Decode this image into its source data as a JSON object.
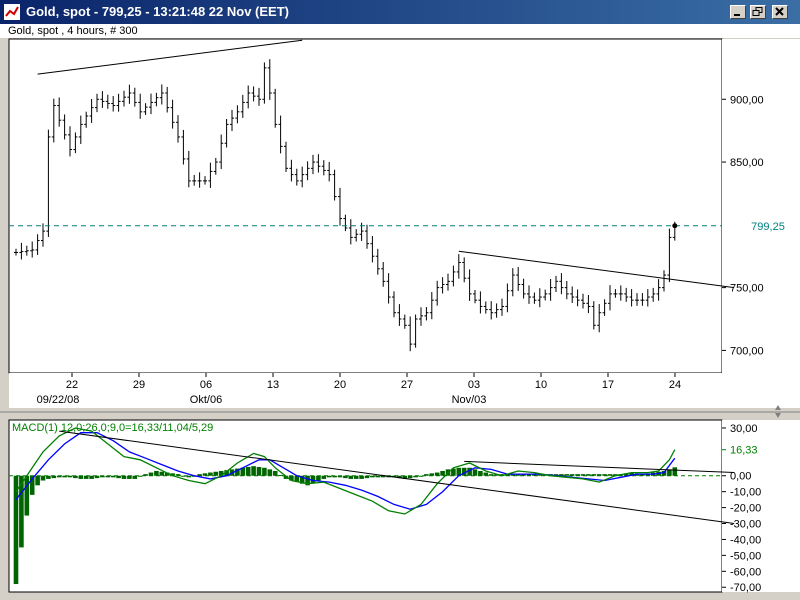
{
  "window": {
    "title": "Gold, spot - 799,25 - 13:21:48  22 Nov (EET)",
    "subtitle": "Gold, spot , 4 hours, # 300"
  },
  "colors": {
    "titlebar": "#0a246a",
    "price_bars": "#000000",
    "last_price_line": "#008080",
    "macd_line": "#008000",
    "signal_line": "#0000ff",
    "histogram": "#006400",
    "trend_lines": "#000000"
  },
  "chart_data": [
    {
      "type": "ohlc",
      "x_tick_labels": [
        "22",
        "29",
        "06",
        "13",
        "20",
        "27",
        "03",
        "10",
        "17",
        "24"
      ],
      "x_month_labels": [
        "09/22/08",
        "Okt/06",
        "Nov/03"
      ],
      "y_tick_labels": [
        "900,00",
        "850,00",
        "750,00",
        "700,00"
      ],
      "ylim": [
        682,
        948
      ],
      "last_price": 799.25,
      "last_price_label": "799,25",
      "close_series": [
        {
          "x": 0,
          "y": 778
        },
        {
          "x": 3,
          "y": 780
        },
        {
          "x": 5,
          "y": 795
        },
        {
          "x": 6,
          "y": 870
        },
        {
          "x": 7,
          "y": 895
        },
        {
          "x": 10,
          "y": 860
        },
        {
          "x": 12,
          "y": 880
        },
        {
          "x": 15,
          "y": 900
        },
        {
          "x": 18,
          "y": 895
        },
        {
          "x": 21,
          "y": 905
        },
        {
          "x": 23,
          "y": 890
        },
        {
          "x": 27,
          "y": 905
        },
        {
          "x": 30,
          "y": 870
        },
        {
          "x": 32,
          "y": 835
        },
        {
          "x": 35,
          "y": 835
        },
        {
          "x": 37,
          "y": 850
        },
        {
          "x": 39,
          "y": 880
        },
        {
          "x": 41,
          "y": 890
        },
        {
          "x": 43,
          "y": 905
        },
        {
          "x": 45,
          "y": 900
        },
        {
          "x": 46,
          "y": 925
        },
        {
          "x": 47,
          "y": 905
        },
        {
          "x": 48,
          "y": 880
        },
        {
          "x": 50,
          "y": 845
        },
        {
          "x": 52,
          "y": 835
        },
        {
          "x": 55,
          "y": 850
        },
        {
          "x": 58,
          "y": 840
        },
        {
          "x": 60,
          "y": 805
        },
        {
          "x": 62,
          "y": 790
        },
        {
          "x": 64,
          "y": 795
        },
        {
          "x": 66,
          "y": 775
        },
        {
          "x": 68,
          "y": 755
        },
        {
          "x": 70,
          "y": 730
        },
        {
          "x": 72,
          "y": 720
        },
        {
          "x": 73,
          "y": 705
        },
        {
          "x": 74,
          "y": 725
        },
        {
          "x": 76,
          "y": 730
        },
        {
          "x": 78,
          "y": 750
        },
        {
          "x": 80,
          "y": 755
        },
        {
          "x": 82,
          "y": 770
        },
        {
          "x": 84,
          "y": 745
        },
        {
          "x": 86,
          "y": 735
        },
        {
          "x": 88,
          "y": 730
        },
        {
          "x": 90,
          "y": 735
        },
        {
          "x": 92,
          "y": 760
        },
        {
          "x": 94,
          "y": 745
        },
        {
          "x": 96,
          "y": 740
        },
        {
          "x": 98,
          "y": 745
        },
        {
          "x": 100,
          "y": 755
        },
        {
          "x": 102,
          "y": 745
        },
        {
          "x": 104,
          "y": 740
        },
        {
          "x": 106,
          "y": 735
        },
        {
          "x": 107,
          "y": 720
        },
        {
          "x": 108,
          "y": 730
        },
        {
          "x": 110,
          "y": 745
        },
        {
          "x": 112,
          "y": 745
        },
        {
          "x": 114,
          "y": 740
        },
        {
          "x": 116,
          "y": 740
        },
        {
          "x": 118,
          "y": 745
        },
        {
          "x": 119,
          "y": 750
        },
        {
          "x": 120,
          "y": 760
        },
        {
          "x": 121,
          "y": 790
        },
        {
          "x": 122,
          "y": 799.25
        }
      ],
      "trend_lines": [
        {
          "x1": 4,
          "y1": 920,
          "x2": 53,
          "y2": 947
        },
        {
          "x1": 82,
          "y1": 779,
          "x2": 133,
          "y2": 750
        }
      ]
    },
    {
      "type": "macd",
      "label": "MACD(1) 12,0;26,0;9,0=16,33/11,04/5,29",
      "y_tick_labels": [
        "30,00",
        "16,33",
        "0,00",
        "-10,00",
        "-20,00",
        "-30,00",
        "-40,00",
        "-50,00",
        "-60,00",
        "-70,00"
      ],
      "ylim": [
        -73,
        35
      ],
      "macd_line": [
        {
          "x": 0,
          "y": -10
        },
        {
          "x": 3,
          "y": 5
        },
        {
          "x": 5,
          "y": 15
        },
        {
          "x": 8,
          "y": 25
        },
        {
          "x": 11,
          "y": 30
        },
        {
          "x": 14,
          "y": 28
        },
        {
          "x": 17,
          "y": 20
        },
        {
          "x": 20,
          "y": 12
        },
        {
          "x": 23,
          "y": 10
        },
        {
          "x": 26,
          "y": 5
        },
        {
          "x": 29,
          "y": 0
        },
        {
          "x": 32,
          "y": -3
        },
        {
          "x": 35,
          "y": -5
        },
        {
          "x": 38,
          "y": 0
        },
        {
          "x": 41,
          "y": 8
        },
        {
          "x": 44,
          "y": 14
        },
        {
          "x": 46,
          "y": 12
        },
        {
          "x": 48,
          "y": 5
        },
        {
          "x": 51,
          "y": -3
        },
        {
          "x": 54,
          "y": -5
        },
        {
          "x": 57,
          "y": -4
        },
        {
          "x": 60,
          "y": -8
        },
        {
          "x": 63,
          "y": -12
        },
        {
          "x": 66,
          "y": -16
        },
        {
          "x": 69,
          "y": -22
        },
        {
          "x": 72,
          "y": -24
        },
        {
          "x": 75,
          "y": -18
        },
        {
          "x": 78,
          "y": -5
        },
        {
          "x": 81,
          "y": 5
        },
        {
          "x": 84,
          "y": 8
        },
        {
          "x": 87,
          "y": 3
        },
        {
          "x": 90,
          "y": 0
        },
        {
          "x": 93,
          "y": 3
        },
        {
          "x": 96,
          "y": 2
        },
        {
          "x": 99,
          "y": 0
        },
        {
          "x": 102,
          "y": -1
        },
        {
          "x": 105,
          "y": -2
        },
        {
          "x": 108,
          "y": -4
        },
        {
          "x": 111,
          "y": 0
        },
        {
          "x": 114,
          "y": 2
        },
        {
          "x": 117,
          "y": 2
        },
        {
          "x": 119,
          "y": 3
        },
        {
          "x": 121,
          "y": 10
        },
        {
          "x": 122,
          "y": 16.33
        }
      ],
      "signal_line": [
        {
          "x": 0,
          "y": -15
        },
        {
          "x": 3,
          "y": -2
        },
        {
          "x": 6,
          "y": 10
        },
        {
          "x": 9,
          "y": 20
        },
        {
          "x": 12,
          "y": 27
        },
        {
          "x": 15,
          "y": 27
        },
        {
          "x": 18,
          "y": 22
        },
        {
          "x": 21,
          "y": 15
        },
        {
          "x": 24,
          "y": 11
        },
        {
          "x": 27,
          "y": 7
        },
        {
          "x": 30,
          "y": 3
        },
        {
          "x": 33,
          "y": 0
        },
        {
          "x": 36,
          "y": -2
        },
        {
          "x": 39,
          "y": 0
        },
        {
          "x": 42,
          "y": 5
        },
        {
          "x": 45,
          "y": 10
        },
        {
          "x": 47,
          "y": 10
        },
        {
          "x": 49,
          "y": 6
        },
        {
          "x": 52,
          "y": 0
        },
        {
          "x": 55,
          "y": -3
        },
        {
          "x": 58,
          "y": -4
        },
        {
          "x": 61,
          "y": -6
        },
        {
          "x": 64,
          "y": -9
        },
        {
          "x": 67,
          "y": -13
        },
        {
          "x": 70,
          "y": -18
        },
        {
          "x": 73,
          "y": -21
        },
        {
          "x": 76,
          "y": -18
        },
        {
          "x": 79,
          "y": -10
        },
        {
          "x": 82,
          "y": 0
        },
        {
          "x": 85,
          "y": 5
        },
        {
          "x": 88,
          "y": 4
        },
        {
          "x": 91,
          "y": 1
        },
        {
          "x": 94,
          "y": 1
        },
        {
          "x": 97,
          "y": 1
        },
        {
          "x": 100,
          "y": 0
        },
        {
          "x": 103,
          "y": -1
        },
        {
          "x": 106,
          "y": -2
        },
        {
          "x": 109,
          "y": -3
        },
        {
          "x": 112,
          "y": -1
        },
        {
          "x": 115,
          "y": 1
        },
        {
          "x": 118,
          "y": 1
        },
        {
          "x": 120,
          "y": 2
        },
        {
          "x": 122,
          "y": 11.04
        }
      ],
      "histogram": [
        {
          "x": 0,
          "y": -68
        },
        {
          "x": 1,
          "y": -45
        },
        {
          "x": 2,
          "y": -25
        },
        {
          "x": 3,
          "y": -12
        },
        {
          "x": 4,
          "y": -6
        },
        {
          "x": 5,
          "y": -3
        },
        {
          "x": 6,
          "y": -2
        },
        {
          "x": 8,
          "y": -1
        },
        {
          "x": 10,
          "y": -1
        },
        {
          "x": 12,
          "y": -2
        },
        {
          "x": 14,
          "y": -2
        },
        {
          "x": 16,
          "y": -1
        },
        {
          "x": 18,
          "y": -1
        },
        {
          "x": 20,
          "y": -2
        },
        {
          "x": 22,
          "y": -2
        },
        {
          "x": 24,
          "y": 1
        },
        {
          "x": 26,
          "y": 3
        },
        {
          "x": 28,
          "y": 2
        },
        {
          "x": 30,
          "y": 1
        },
        {
          "x": 32,
          "y": -1
        },
        {
          "x": 34,
          "y": 1
        },
        {
          "x": 36,
          "y": 2
        },
        {
          "x": 38,
          "y": 3
        },
        {
          "x": 40,
          "y": 4
        },
        {
          "x": 42,
          "y": 5
        },
        {
          "x": 44,
          "y": 6
        },
        {
          "x": 46,
          "y": 5
        },
        {
          "x": 48,
          "y": 3
        },
        {
          "x": 50,
          "y": -2
        },
        {
          "x": 52,
          "y": -4
        },
        {
          "x": 54,
          "y": -6
        },
        {
          "x": 56,
          "y": -3
        },
        {
          "x": 58,
          "y": -1
        },
        {
          "x": 60,
          "y": -1
        },
        {
          "x": 62,
          "y": -2
        },
        {
          "x": 64,
          "y": -2
        },
        {
          "x": 66,
          "y": -1
        },
        {
          "x": 68,
          "y": -1
        },
        {
          "x": 70,
          "y": -1
        },
        {
          "x": 72,
          "y": -2
        },
        {
          "x": 74,
          "y": -1
        },
        {
          "x": 76,
          "y": 1
        },
        {
          "x": 78,
          "y": 2
        },
        {
          "x": 80,
          "y": 4
        },
        {
          "x": 82,
          "y": 5
        },
        {
          "x": 84,
          "y": 5
        },
        {
          "x": 86,
          "y": 3
        },
        {
          "x": 88,
          "y": 1
        },
        {
          "x": 90,
          "y": 1
        },
        {
          "x": 92,
          "y": 1
        },
        {
          "x": 94,
          "y": 1
        },
        {
          "x": 96,
          "y": 1
        },
        {
          "x": 98,
          "y": 1
        },
        {
          "x": 100,
          "y": 1
        },
        {
          "x": 102,
          "y": 1
        },
        {
          "x": 104,
          "y": 1
        },
        {
          "x": 106,
          "y": 1
        },
        {
          "x": 108,
          "y": 1
        },
        {
          "x": 110,
          "y": 1
        },
        {
          "x": 112,
          "y": 1
        },
        {
          "x": 114,
          "y": 2
        },
        {
          "x": 116,
          "y": 1
        },
        {
          "x": 118,
          "y": 2
        },
        {
          "x": 120,
          "y": 3
        },
        {
          "x": 121,
          "y": 4
        },
        {
          "x": 122,
          "y": 5.29
        }
      ],
      "trend_lines": [
        {
          "x1": 8,
          "y1": 28,
          "x2": 133,
          "y2": -30
        },
        {
          "x1": 83,
          "y1": 9,
          "x2": 133,
          "y2": 2
        }
      ]
    }
  ]
}
